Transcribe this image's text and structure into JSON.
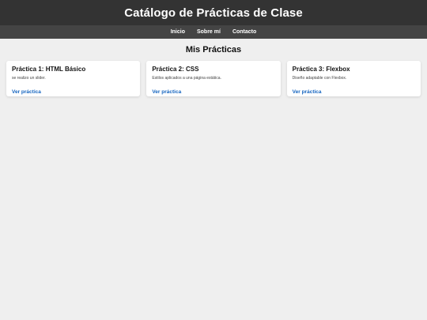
{
  "header": {
    "title": "Catálogo de Prácticas de Clase"
  },
  "nav": {
    "items": [
      "Inicio",
      "Sobre mí",
      "Contacto"
    ]
  },
  "main": {
    "section_title": "Mis Prácticas",
    "cards": [
      {
        "title": "Práctica 1: HTML Básico",
        "description": "se realizo un slider.",
        "link": "Ver práctica"
      },
      {
        "title": "Práctica 2: CSS",
        "description": "Estilos aplicados a una página estática.",
        "link": "Ver práctica"
      },
      {
        "title": "Práctica 3: Flexbox",
        "description": "Diseño adaptable con Flexbox.",
        "link": "Ver práctica"
      }
    ]
  },
  "colors": {
    "header_bg": "#333333",
    "nav_bg": "#444444",
    "page_bg": "#efefef",
    "link": "#1565c0"
  }
}
